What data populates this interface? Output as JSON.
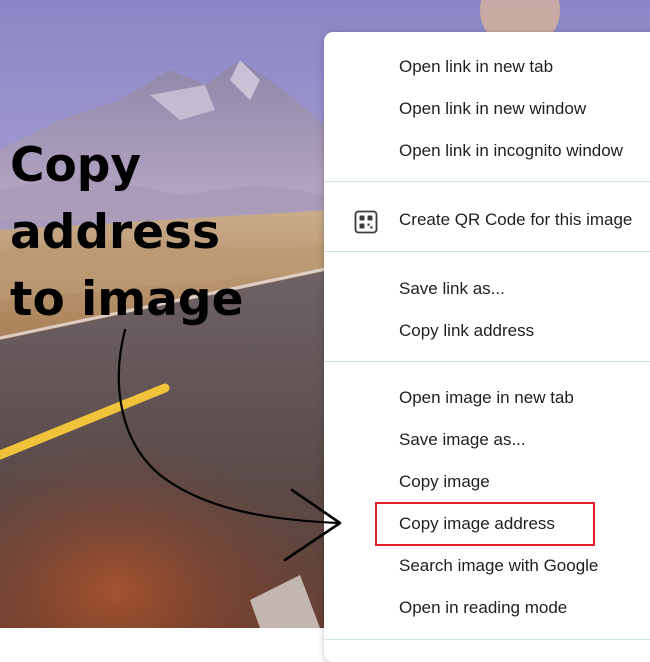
{
  "annotation": {
    "lines": [
      "Copy",
      "address",
      "to image"
    ]
  },
  "context_menu": {
    "groups": [
      {
        "items": [
          {
            "label": "Open link in new tab"
          },
          {
            "label": "Open link in new window"
          },
          {
            "label": "Open link in incognito window"
          }
        ]
      },
      {
        "items": [
          {
            "label": "Create QR Code for this image",
            "icon": "qr-code-icon"
          }
        ]
      },
      {
        "items": [
          {
            "label": "Save link as..."
          },
          {
            "label": "Copy link address"
          }
        ]
      },
      {
        "items": [
          {
            "label": "Open image in new tab"
          },
          {
            "label": "Save image as..."
          },
          {
            "label": "Copy image"
          },
          {
            "label": "Copy image address",
            "highlighted": true
          },
          {
            "label": "Search image with Google"
          },
          {
            "label": "Open in reading mode"
          }
        ]
      }
    ]
  },
  "colors": {
    "highlight_border": "#e0202a",
    "menu_divider": "#cfe3ea",
    "menu_text": "#1f1f1f"
  }
}
